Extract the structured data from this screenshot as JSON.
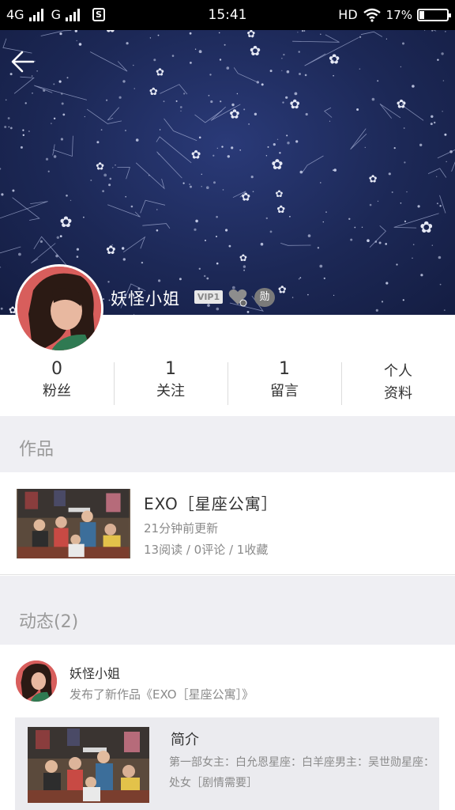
{
  "status_bar": {
    "network1": "4G",
    "network2": "G",
    "sim_icon": "S",
    "time": "15:41",
    "hd": "HD",
    "battery": "17%",
    "battery_level": 0.17
  },
  "profile": {
    "username": "妖怪小姐",
    "vip_badge": "VIP1",
    "xun_badge": "勋"
  },
  "stats": [
    {
      "value": "0",
      "label": "粉丝"
    },
    {
      "value": "1",
      "label": "关注"
    },
    {
      "value": "1",
      "label": "留言"
    },
    {
      "line1": "个人",
      "line2": "资料"
    }
  ],
  "works_section": {
    "title": "作品",
    "item": {
      "title": "EXO［星座公寓］",
      "updated": "21分钟前更新",
      "stats": "13阅读 / 0评论 / 1收藏"
    }
  },
  "feed_section": {
    "title": "动态(2)",
    "item": {
      "user": "妖怪小姐",
      "action": "发布了新作品《EXO［星座公寓］》",
      "card_title": "简介",
      "card_text": "第一部女主：白允恩星座：白羊座男主：吴世勋星座：处女［剧情需要］"
    }
  },
  "icons": {
    "back": "arrow-left-icon",
    "heart_badge": "heart-badge-icon",
    "wifi": "wifi-icon"
  },
  "colors": {
    "banner": "#1c2856",
    "section_gray": "#efeff3"
  }
}
